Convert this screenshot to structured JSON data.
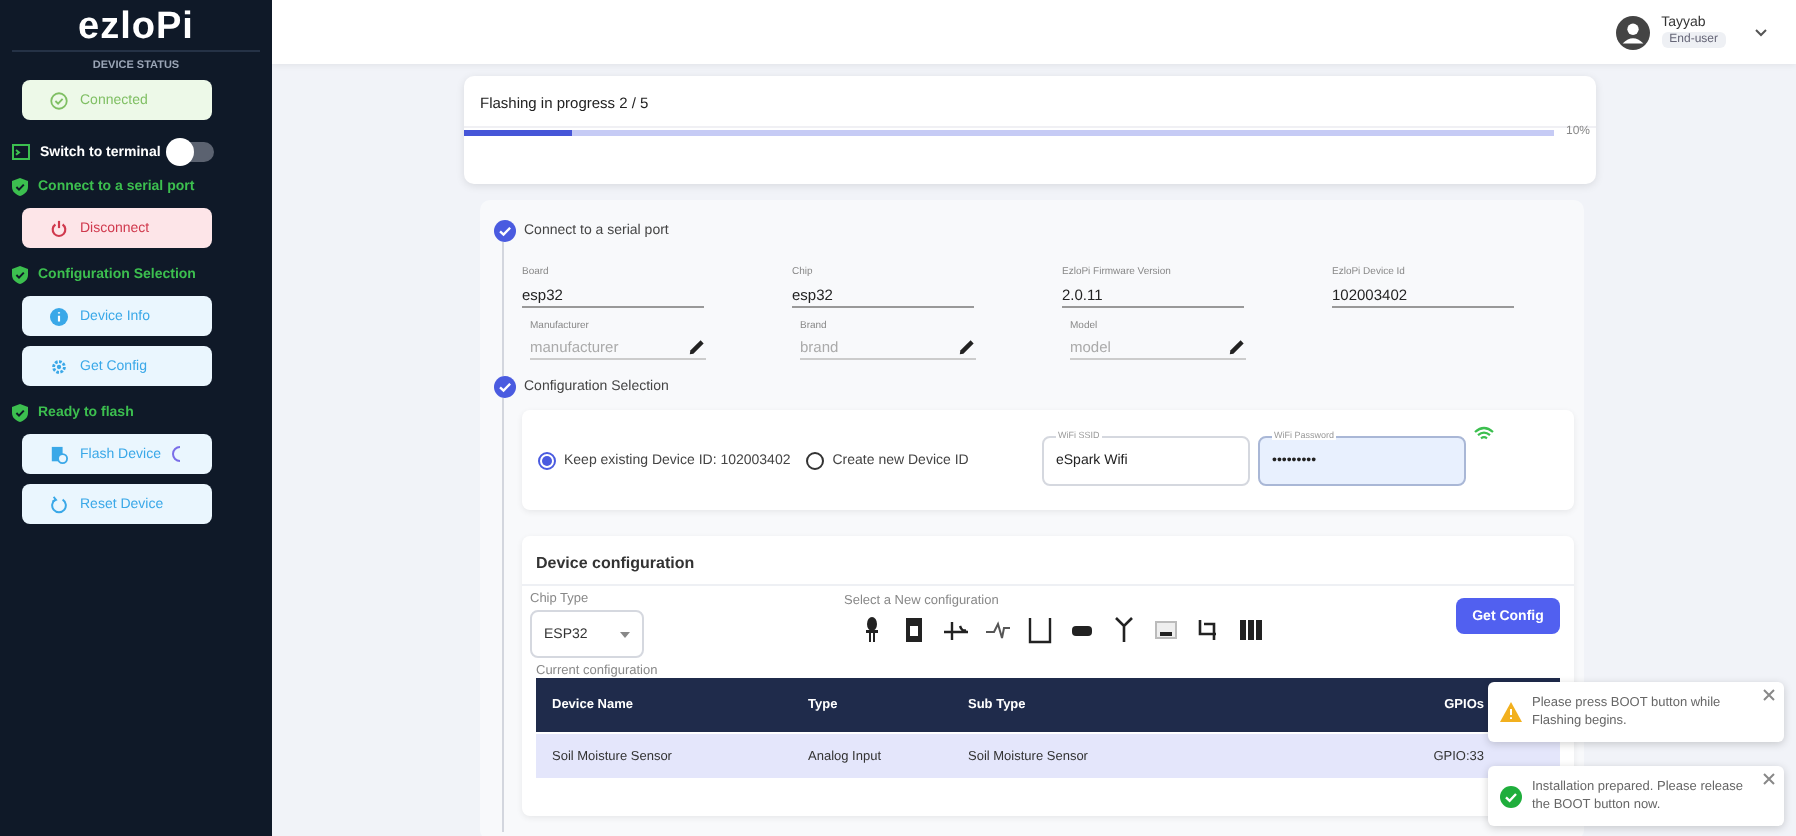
{
  "sidebar": {
    "logo": "ezloPi",
    "status_title": "DEVICE STATUS",
    "status_button": {
      "label": "Connected",
      "kind": "success"
    },
    "terminal": {
      "label": "Switch to terminal",
      "on": false
    },
    "steps": [
      {
        "label": "Connect to a serial port",
        "done": true,
        "buttons": [
          {
            "label": "Disconnect",
            "kind": "danger",
            "busy": false
          }
        ]
      },
      {
        "label": "Configuration Selection",
        "done": true,
        "buttons": [
          {
            "label": "Device Info",
            "kind": "info",
            "busy": false
          },
          {
            "label": "Get Config",
            "kind": "info",
            "busy": false
          }
        ]
      },
      {
        "label": "Ready to flash",
        "done": true,
        "buttons": [
          {
            "label": "Flash Device",
            "kind": "info",
            "busy": true
          },
          {
            "label": "Reset Device",
            "kind": "info",
            "busy": false
          }
        ]
      }
    ]
  },
  "header": {
    "user": {
      "name": "Tayyab",
      "role": "End-user"
    }
  },
  "progress": {
    "title": "Flashing in progress 2 / 5",
    "level": 0.1,
    "reading": "10%"
  },
  "stepper": [
    {
      "label": "Connect to a serial port",
      "done": true
    },
    {
      "label": "Configuration Selection",
      "done": true
    }
  ],
  "device_fields": [
    {
      "label": "Board",
      "value": "esp32"
    },
    {
      "label": "Chip",
      "value": "esp32"
    },
    {
      "label": "EzloPi Firmware Version",
      "value": "2.0.11"
    },
    {
      "label": "EzloPi Device Id",
      "value": "102003402"
    }
  ],
  "editable_fields": [
    {
      "label": "Manufacturer",
      "placeholder": "manufacturer"
    },
    {
      "label": "Brand",
      "placeholder": "brand"
    },
    {
      "label": "Model",
      "placeholder": "model"
    }
  ],
  "device_id_options": [
    {
      "label": "Keep existing Device ID: 102003402",
      "selected": true
    },
    {
      "label": "Create new Device ID",
      "selected": false
    }
  ],
  "wifi": [
    {
      "label": "WiFi SSID",
      "value": "eSpark Wifi",
      "focused": false
    },
    {
      "label": "WiFi Password",
      "value": "•••••••••",
      "focused": true
    }
  ],
  "device_configuration": {
    "title": "Device configuration",
    "chip_type": {
      "label": "Chip Type",
      "value": "ESP32"
    },
    "select_label": "Select a New configuration",
    "button": "Get Config",
    "current_label": "Current configuration",
    "table": {
      "columns": [
        "Device Name",
        "Type",
        "Sub Type",
        "GPIOs"
      ],
      "rows": [
        [
          "Soil Moisture Sensor",
          "Analog Input",
          "Soil Moisture Sensor",
          "GPIO:33"
        ]
      ]
    }
  },
  "toasts": [
    {
      "kind": "warning",
      "message": "Please press BOOT button while Flashing begins."
    },
    {
      "kind": "success",
      "message": "Installation prepared. Please release the BOOT button now."
    }
  ]
}
